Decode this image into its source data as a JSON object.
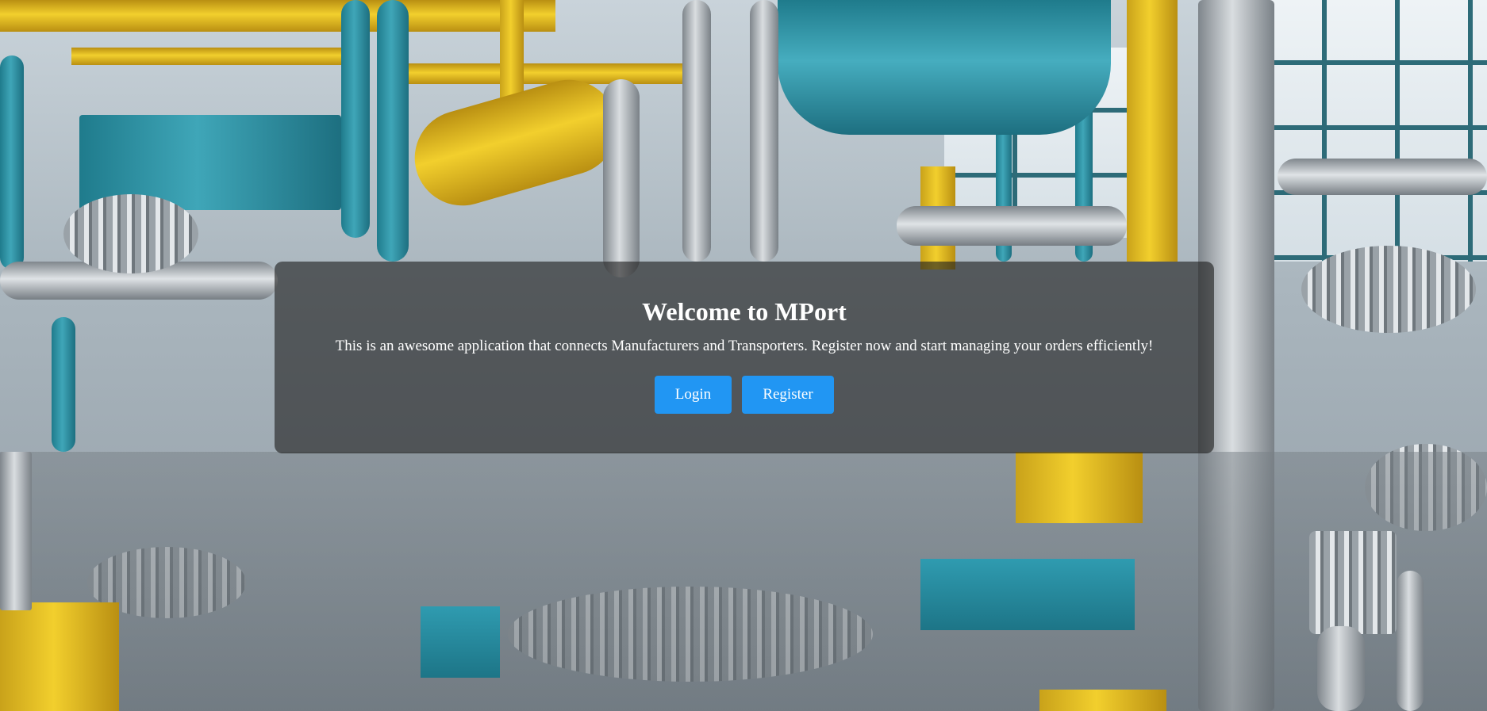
{
  "hero": {
    "title": "Welcome to MPort",
    "subtitle": "This is an awesome application that connects Manufacturers and Transporters. Register now and start managing your orders efficiently!"
  },
  "actions": {
    "login_label": "Login",
    "register_label": "Register"
  },
  "colors": {
    "button": "#2196f3",
    "card_overlay": "rgba(30,30,30,0.62)",
    "text": "#ffffff"
  }
}
